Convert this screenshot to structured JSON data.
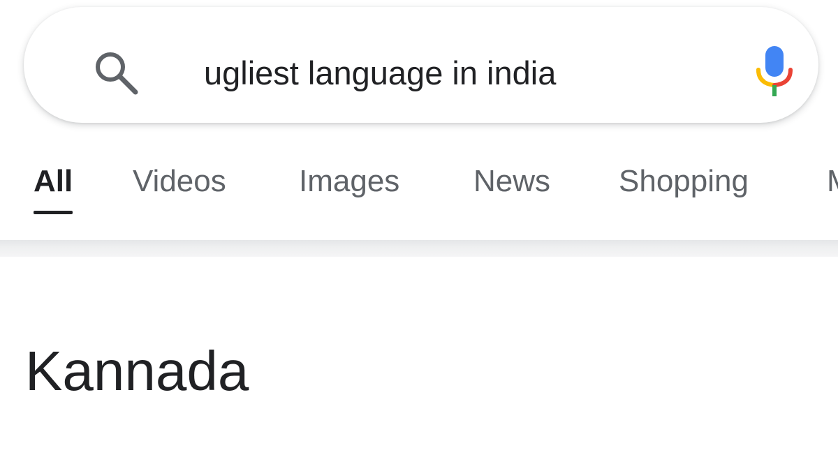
{
  "search": {
    "query": "ugliest language in india",
    "icon": "search-icon",
    "voice_icon": "mic-icon",
    "mic_colors": {
      "blue": "#4285F4",
      "red": "#EA4335",
      "yellow": "#FBBC05",
      "green": "#34A853"
    }
  },
  "tabs": [
    {
      "label": "All",
      "active": true
    },
    {
      "label": "Videos",
      "active": false
    },
    {
      "label": "Images",
      "active": false
    },
    {
      "label": "News",
      "active": false
    },
    {
      "label": "Shopping",
      "active": false
    },
    {
      "label": "M",
      "active": false
    }
  ],
  "result": {
    "answer": "Kannada"
  }
}
